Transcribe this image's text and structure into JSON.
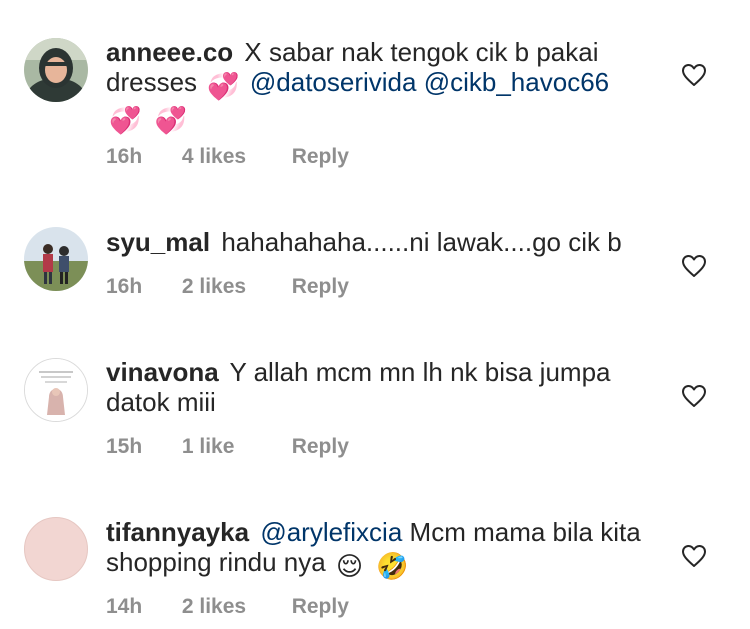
{
  "comments": [
    {
      "username": "anneee.co",
      "text1": "X sabar nak tengok cik b pakai dresses",
      "emoji1": "💞",
      "mention1": "@datoserivida",
      "mention2": "@cikb_havoc66",
      "emoji2": "💞",
      "emoji3": "💞",
      "time": "16h",
      "likes": "4 likes",
      "reply": "Reply"
    },
    {
      "username": "syu_mal",
      "text1": "hahahahaha......ni lawak....go cik b",
      "time": "16h",
      "likes": "2 likes",
      "reply": "Reply"
    },
    {
      "username": "vinavona",
      "text1": "Y allah mcm mn lh nk bisa jumpa datok miii",
      "time": "15h",
      "likes": "1 like",
      "reply": "Reply"
    },
    {
      "username": "tifannyayka",
      "mention1": "@arylefixcia",
      "text1": "Mcm mama bila kita shopping rindu nya",
      "emoji1": "😌",
      "emoji2": "🤣",
      "time": "14h",
      "likes": "2 likes",
      "reply": "Reply"
    }
  ],
  "icons": {
    "like": "heart-outline-icon"
  },
  "colors": {
    "text": "#262626",
    "meta": "#8e8e8e",
    "mention": "#003569",
    "avatar4": "#f2d6d2"
  }
}
